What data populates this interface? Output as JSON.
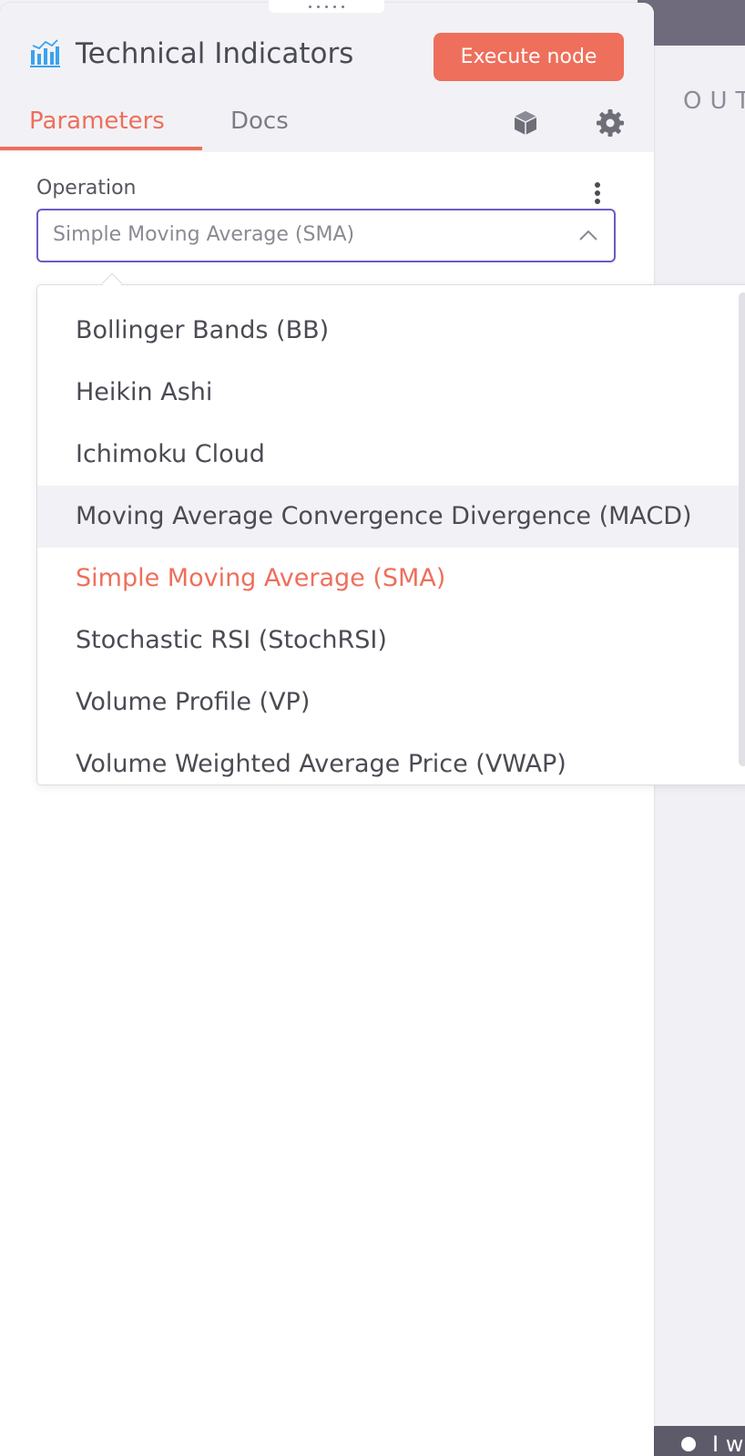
{
  "output_panel": {
    "label": "OUT",
    "bottom_text": "I w"
  },
  "node": {
    "title": "Technical Indicators",
    "icon": "bar-chart-icon",
    "execute_label": "Execute node"
  },
  "tabs": [
    {
      "label": "Parameters",
      "active": true
    },
    {
      "label": "Docs",
      "active": false
    }
  ],
  "header_icons": [
    "cube-icon",
    "gear-icon"
  ],
  "operation": {
    "label": "Operation",
    "value": "Simple Moving Average (SMA)",
    "options": [
      {
        "label": "Bollinger Bands (BB)"
      },
      {
        "label": "Heikin Ashi"
      },
      {
        "label": "Ichimoku Cloud"
      },
      {
        "label": "Moving Average Convergence Divergence (MACD)",
        "hovered": true
      },
      {
        "label": "Simple Moving Average (SMA)",
        "selected": true
      },
      {
        "label": "Stochastic RSI (StochRSI)"
      },
      {
        "label": "Volume Profile (VP)"
      },
      {
        "label": "Volume Weighted Average Price (VWAP)"
      }
    ]
  },
  "colors": {
    "accent": "#ee6f5b",
    "focus_border": "#6a5cc4",
    "icon_blue": "#3aa3ee"
  }
}
